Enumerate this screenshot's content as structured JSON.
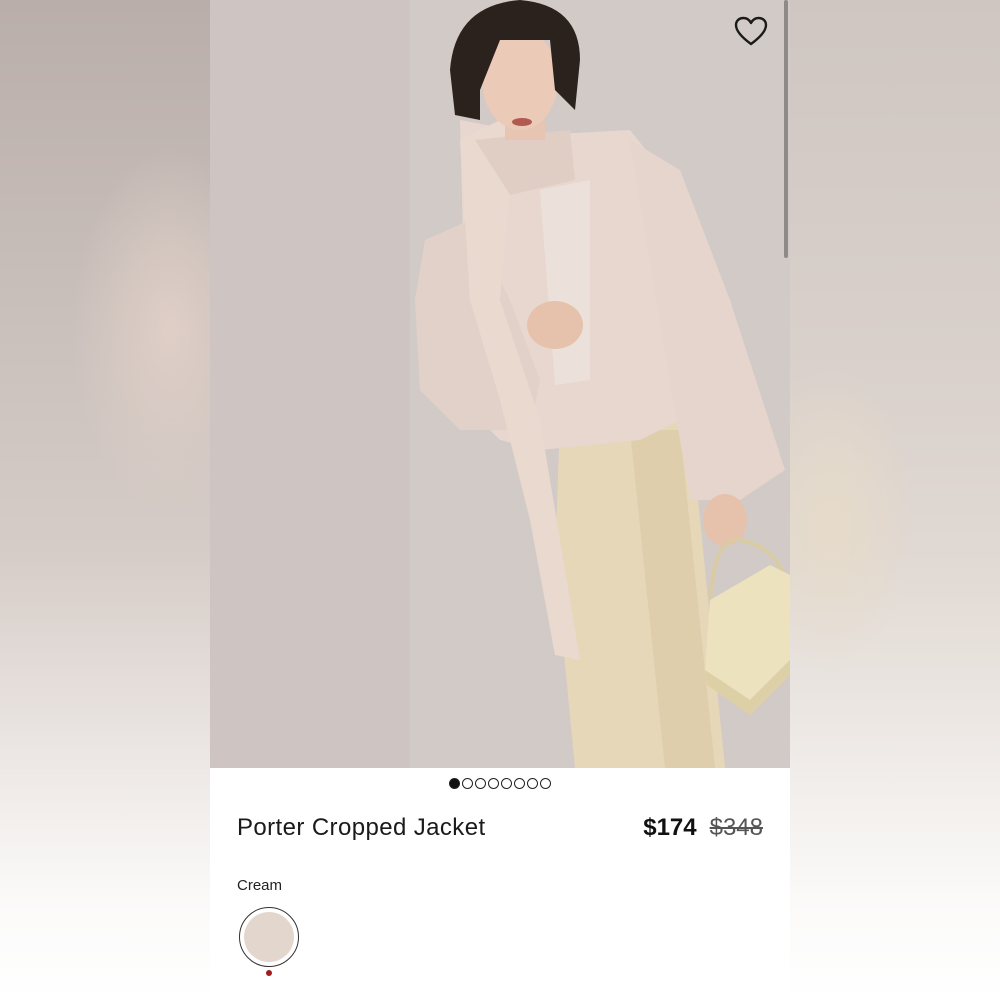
{
  "product": {
    "name": "Porter Cropped Jacket",
    "sale_price": "$174",
    "original_price": "$348"
  },
  "gallery": {
    "image_count": 8,
    "active_index": 0
  },
  "color": {
    "selected_label": "Cream",
    "swatch_hex": "#e3d6cd",
    "marker_hex": "#a11d1d"
  },
  "icons": {
    "wishlist": "heart-outline-icon"
  }
}
